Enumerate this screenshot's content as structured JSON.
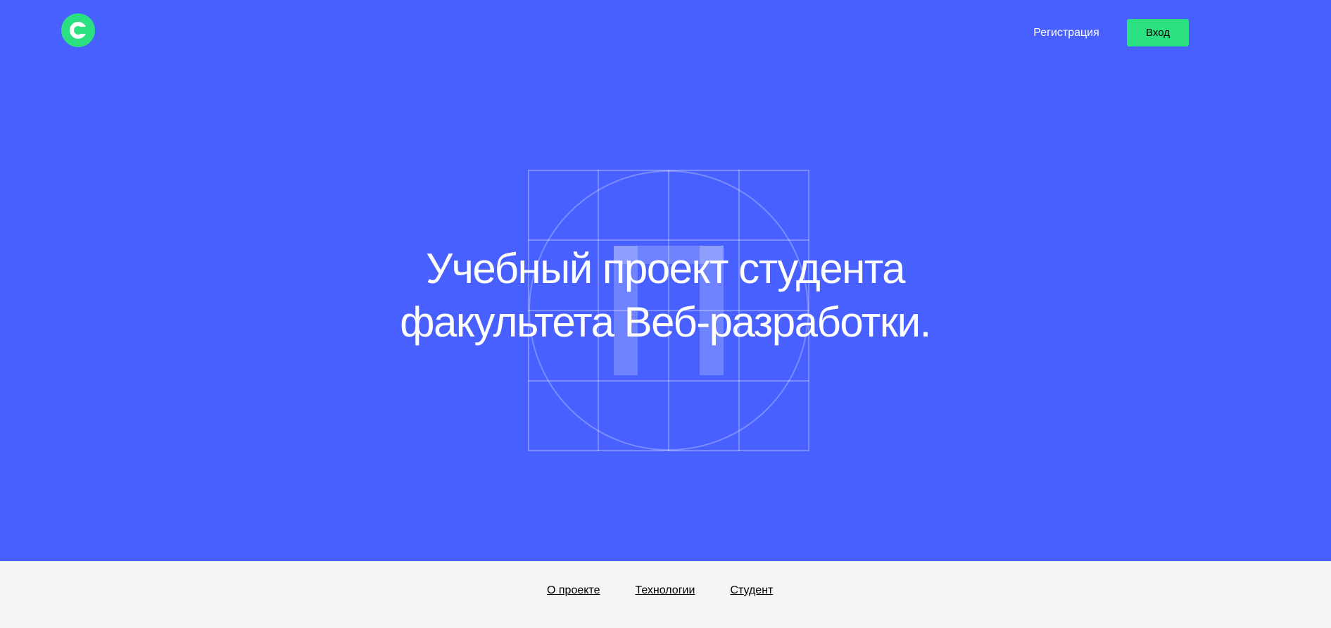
{
  "header": {
    "logo_icon": "c-logo-icon",
    "register_label": "Регистрация",
    "login_label": "Вход"
  },
  "hero": {
    "title_line_1": "Учебный проект студента",
    "title_line_2": "факультета Веб-разработки.",
    "background_icon": "grid-pi-emblem-icon"
  },
  "footer": {
    "links": [
      {
        "label": "О проекте"
      },
      {
        "label": "Технологии"
      },
      {
        "label": "Студент"
      }
    ]
  },
  "colors": {
    "hero_background": "#4760ff",
    "accent_green": "#2be080",
    "footer_background": "#f5f5f5",
    "text_light": "#ffffff",
    "text_dark": "#000000"
  }
}
